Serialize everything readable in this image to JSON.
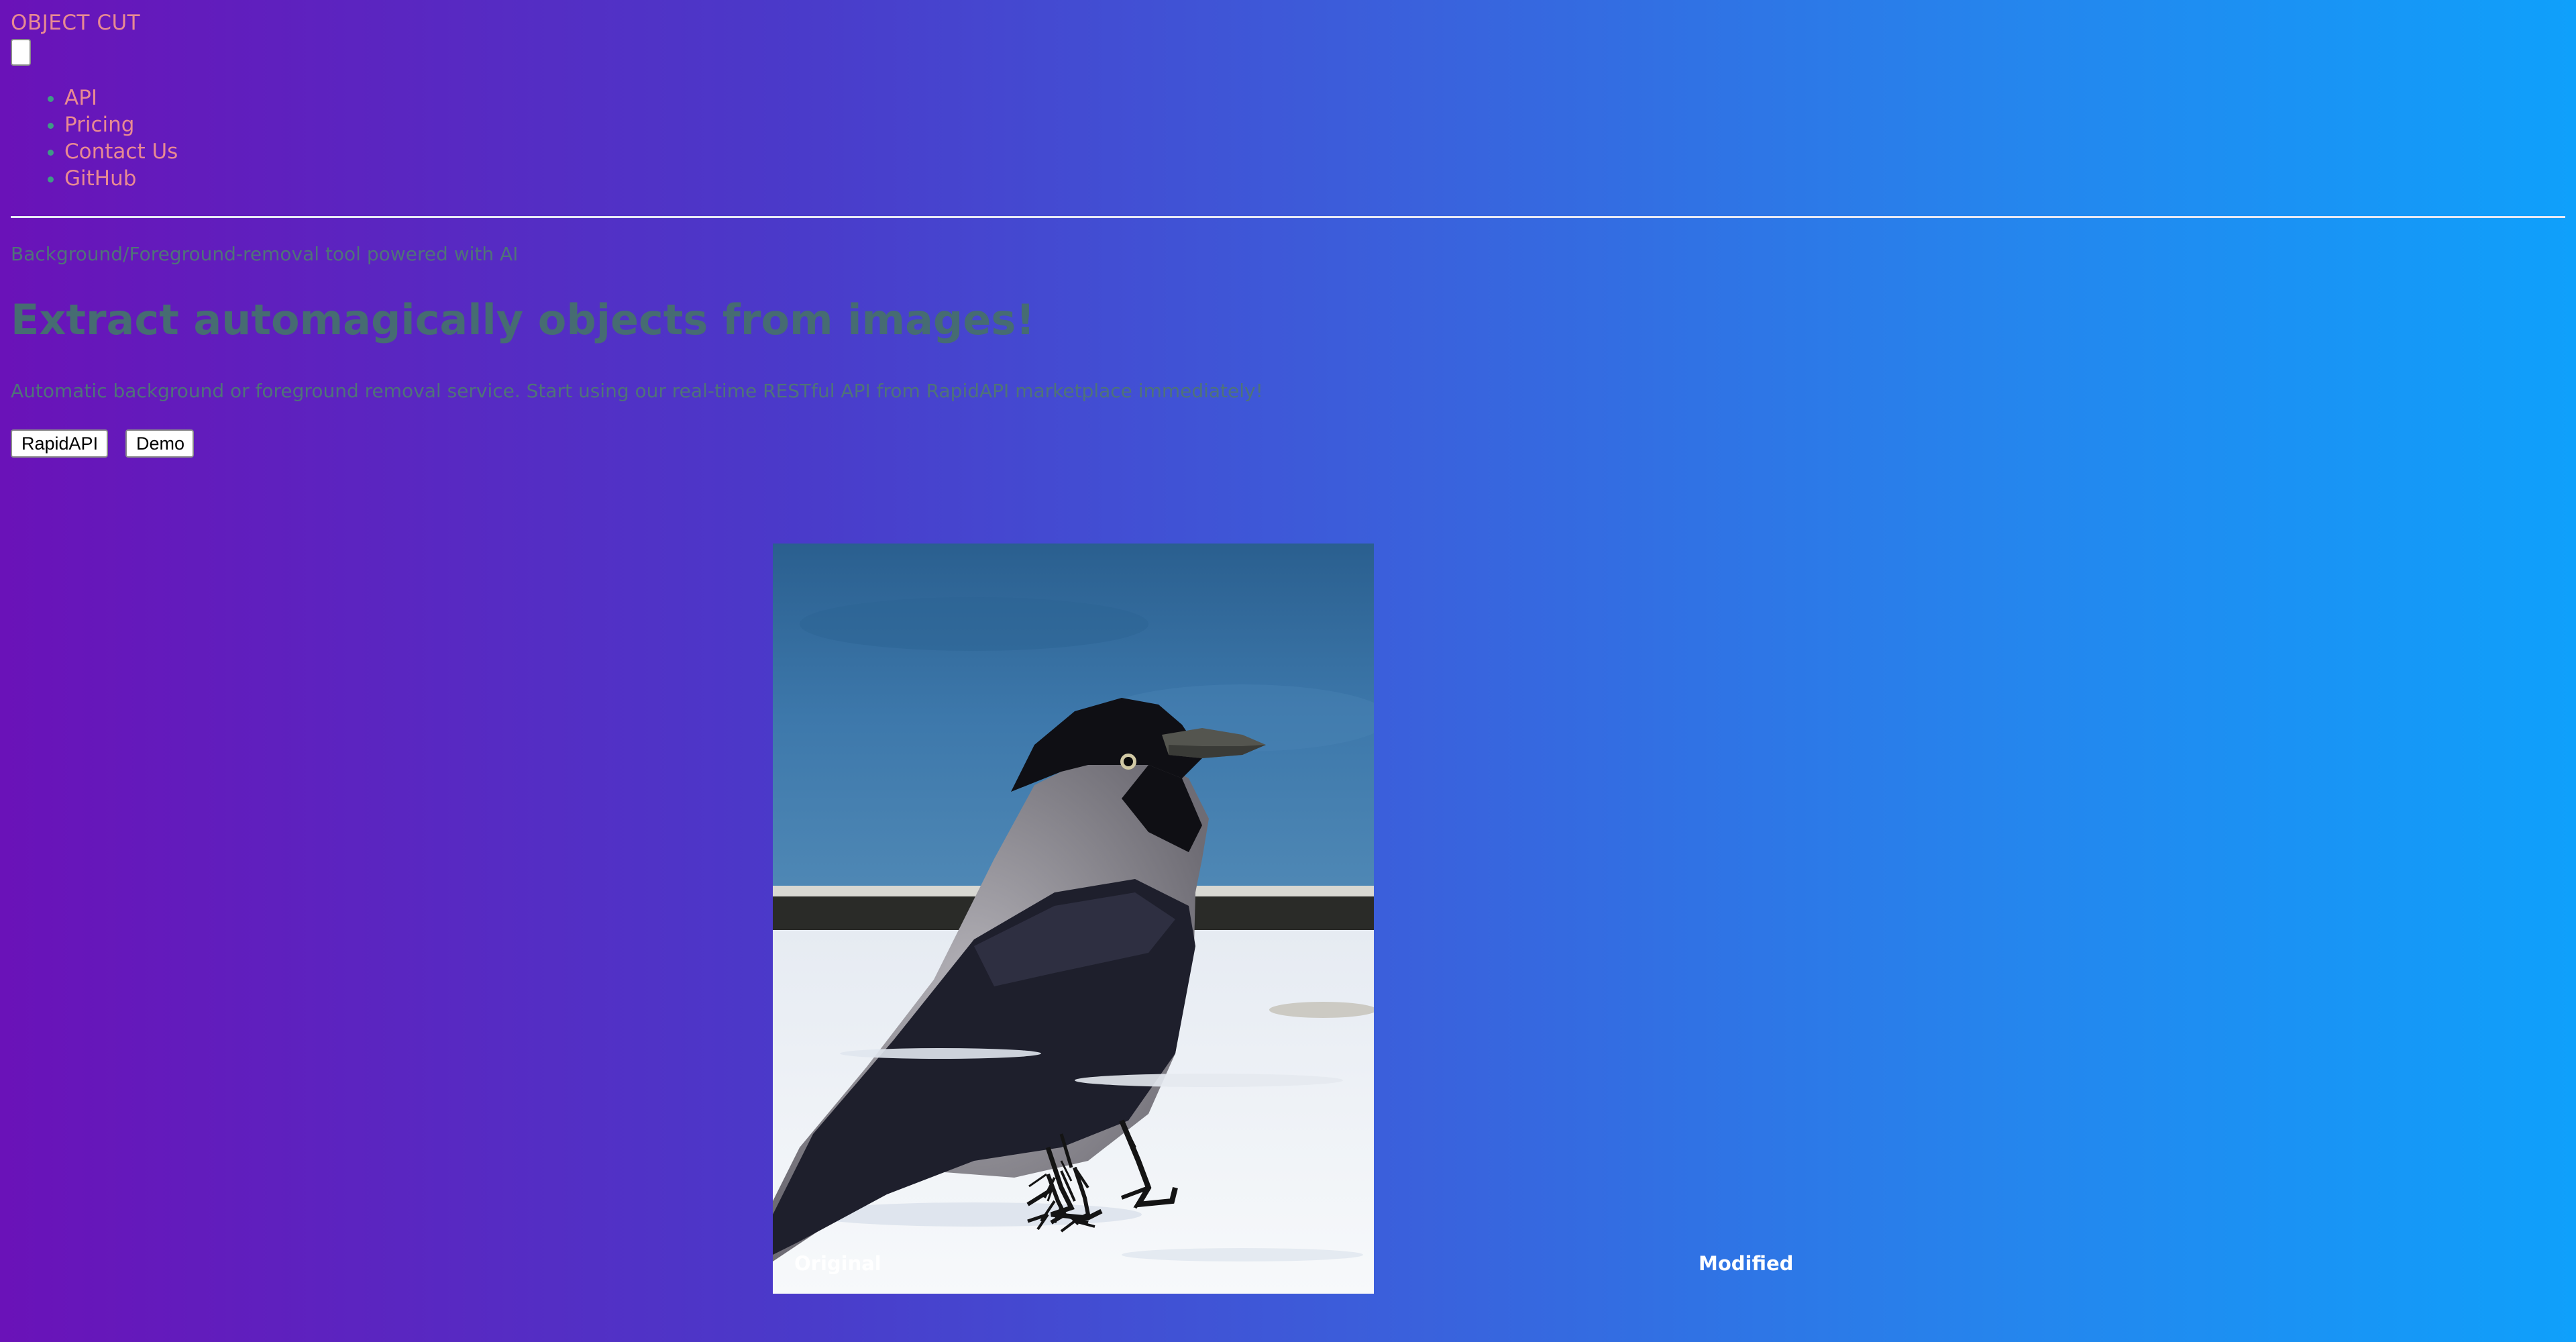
{
  "header": {
    "brand": "OBJECT CUT",
    "nav": [
      {
        "label": "API"
      },
      {
        "label": "Pricing"
      },
      {
        "label": "Contact Us"
      },
      {
        "label": "GitHub"
      }
    ]
  },
  "hero": {
    "tagline": "Background/Foreground-removal tool powered with AI",
    "title": "Extract automagically objects from images!",
    "description": "Automatic background or foreground removal service. Start using our real-time RESTful API from RapidAPI marketplace immediately!",
    "buttons": {
      "rapidapi": "RapidAPI",
      "demo": "Demo"
    }
  },
  "comparison": {
    "original_label": "Original",
    "modified_label": "Modified",
    "image_subject": "hooded crow standing on snow"
  },
  "colors": {
    "gradient_start": "#6a12b8",
    "gradient_end": "#0fa0fb",
    "link": "#e88a92",
    "text_muted": "#4f7378"
  }
}
